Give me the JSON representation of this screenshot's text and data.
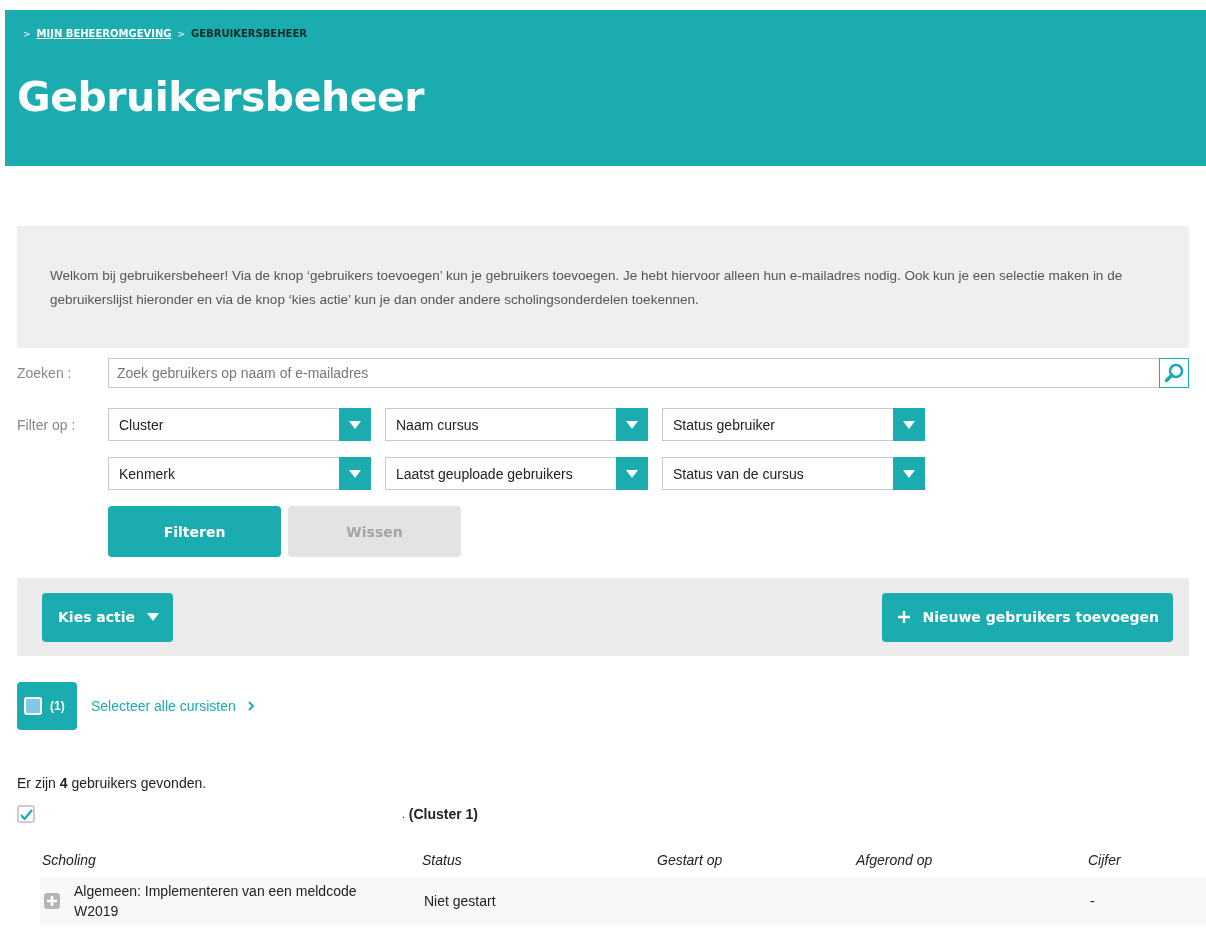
{
  "breadcrumb": [
    {
      "sep": ">",
      "label": "MIJN BEHEEROMGEVING",
      "link": true
    },
    {
      "sep": ">",
      "label": "GEBRUIKERSBEHEER",
      "link": false
    }
  ],
  "title": "Gebruikersbeheer",
  "intro": "Welkom bij gebruikersbeheer! Via de knop ‘gebruikers toevoegen’ kun je gebruikers toevoegen. Je hebt hiervoor alleen hun e-mailadres nodig. Ook kun je een selectie maken in de gebruikerslijst hieronder en via de knop ‘kies actie’ kun je dan onder andere scholingsonderdelen toekennen.",
  "search": {
    "label": "Zoeken :",
    "placeholder": "Zoek gebruikers op naam of e-mailadres"
  },
  "filter": {
    "label": "Filter op :",
    "dropdowns": [
      {
        "value": "Cluster"
      },
      {
        "value": "Naam cursus"
      },
      {
        "value": "Status gebruiker"
      },
      {
        "value": "Kenmerk"
      },
      {
        "value": "Laatst geuploade gebruikers"
      },
      {
        "value": "Status van de cursus"
      }
    ],
    "buttons": [
      {
        "label": "Filteren",
        "disabled": false
      },
      {
        "label": "Wissen",
        "disabled": true
      }
    ]
  },
  "actions": {
    "choose": "Kies actie",
    "add": "Nieuwe gebruikers toevoegen"
  },
  "select_all": {
    "indeterminate": true,
    "count": "(1)",
    "link": "Selecteer alle cursisten"
  },
  "found": "Er zijn **4** gebruikers gevonden.",
  "user": {
    "checked": true,
    "name": ".",
    "cluster": "(Cluster 1)"
  },
  "table": {
    "columns": [
      "Scholing",
      "Status",
      "Gestart op",
      "Afgerond op",
      "Cijfer"
    ],
    "rows": [
      {
        "cells": [
          "Algemeen: Implementeren van een meldcode W2019",
          "Niet gestart",
          "",
          "",
          "-"
        ],
        "expanded": false
      }
    ]
  }
}
